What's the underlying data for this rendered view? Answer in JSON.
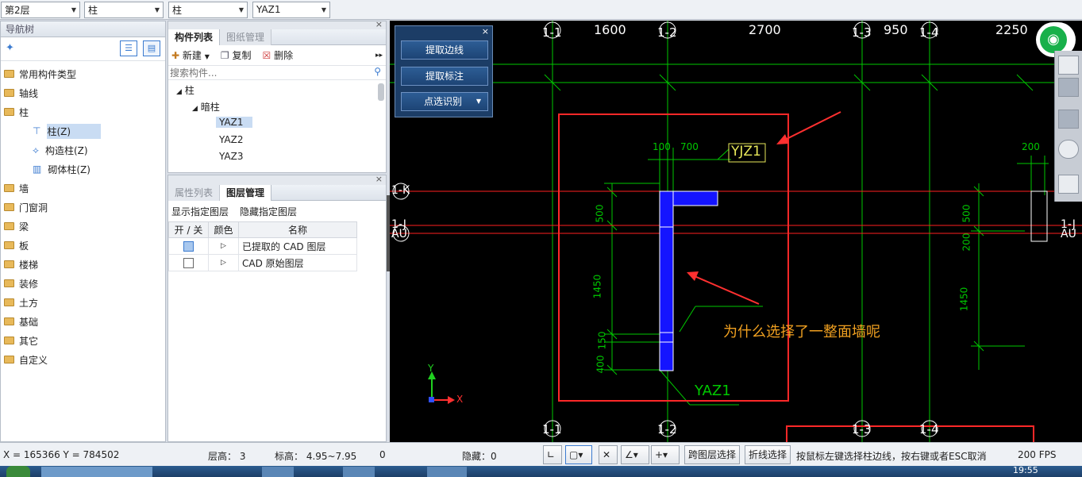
{
  "toolbar": {
    "floor": "第2层",
    "category": "柱",
    "type": "柱",
    "element": "YAZ1"
  },
  "nav": {
    "title": "导航树",
    "items": [
      {
        "label": "常用构件类型"
      },
      {
        "label": "轴线"
      },
      {
        "label": "柱"
      },
      {
        "label": "柱(Z)"
      },
      {
        "label": "构造柱(Z)"
      },
      {
        "label": "砌体柱(Z)"
      },
      {
        "label": "墙"
      },
      {
        "label": "门窗洞"
      },
      {
        "label": "梁"
      },
      {
        "label": "板"
      },
      {
        "label": "楼梯"
      },
      {
        "label": "装修"
      },
      {
        "label": "土方"
      },
      {
        "label": "基础"
      },
      {
        "label": "其它"
      },
      {
        "label": "自定义"
      }
    ]
  },
  "comp": {
    "tab1": "构件列表",
    "tab2": "图纸管理",
    "new": "新建",
    "copy": "复制",
    "del": "删除",
    "search_ph": "搜索构件...",
    "t_col": "柱",
    "t_dark": "暗柱",
    "items": [
      "YAZ1",
      "YAZ2",
      "YAZ3"
    ]
  },
  "layer": {
    "tab1": "属性列表",
    "tab2": "图层管理",
    "show": "显示指定图层",
    "hide": "隐藏指定图层",
    "h_on": "开 / 关",
    "h_color": "颜色",
    "h_name": "名称",
    "rows": [
      {
        "name": "已提取的 CAD 图层"
      },
      {
        "name": "CAD 原始图层"
      }
    ]
  },
  "float": {
    "b1": "提取边线",
    "b2": "提取标注",
    "b3": "点选识别"
  },
  "cad": {
    "axes_top": [
      "1-1",
      "1-2",
      "1-3",
      "1-4"
    ],
    "axes_bottom": [
      "1-1",
      "1-2",
      "1-3",
      "1-4"
    ],
    "dims_top": [
      "1600",
      "2700",
      "950",
      "2250"
    ],
    "axes_left": [
      "1-K",
      "1-J",
      "AU"
    ],
    "axes_right": [
      "1-J",
      "AU"
    ],
    "dim_small": [
      "100",
      "700"
    ],
    "dim_v": [
      "500",
      "1450",
      "150",
      "400"
    ],
    "dim_v_right": [
      "500",
      "200",
      "1450"
    ],
    "dim_right_top": "200",
    "label_top": "YJZ1",
    "label_bottom": "YAZ1",
    "question": "为什么选择了一整面墙呢",
    "y": "Y",
    "x": "X"
  },
  "status": {
    "coords": "X = 165366 Y = 784502",
    "floor_h": "层高： 3",
    "elev": "标高： 4.95~7.95",
    "zero": "0",
    "hidden": "隐藏：0",
    "cross": "跨图层选择",
    "fold": "折线选择",
    "hint": "按鼠标左键选择柱边线，按右键或者ESC取消",
    "fps": "200 FPS",
    "time": "19:55"
  }
}
